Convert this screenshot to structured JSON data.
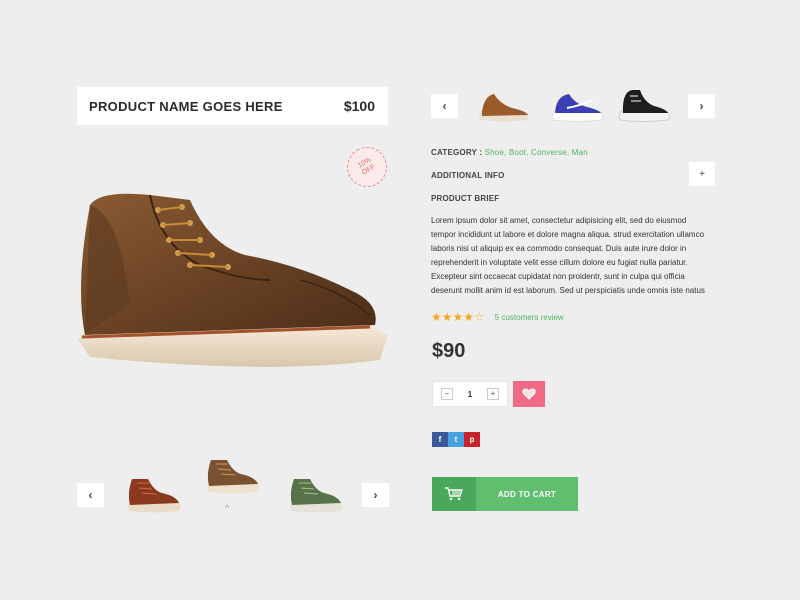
{
  "product": {
    "name": "PRODUCT NAME GOES HERE",
    "price": "$100"
  },
  "badge": {
    "line1": "10%",
    "line2": "OFF"
  },
  "gallery": {
    "prev_icon": "chevron-left-icon",
    "next_icon": "chevron-right-icon",
    "thumbnails": [
      "brown-boot",
      "tan-boot",
      "green-boot"
    ]
  },
  "related": {
    "prev_icon": "chevron-left-icon",
    "next_icon": "chevron-right-icon",
    "items": [
      "brown-casual-shoe",
      "blue-sneaker",
      "black-high-top"
    ]
  },
  "details": {
    "category_label": "CATEGORY :",
    "category_values": "Shoe, Boot, Converse, Man",
    "additional_info_label": "ADDITIONAL INFO",
    "brief_label": "PRODUCT BRIEF",
    "brief_lines": [
      "Lorem ipsum dolor sit amet, consectetur adipisicing elit, sed do eiusmod",
      "tempor incididunt ut labore et dolore magna aliqua. strud exercitation ullamco",
      "laboris nisi ut aliquip ex ea commodo consequat. Duis aute irure dolor in",
      "reprehenderit in voluptate velit esse cillum dolore eu fugiat nulla pariatur.",
      "Excepteur sint occaecat cupidatat non proidentr, sunt in culpa qui officia",
      "deserunt mollit anim id est laborum.  Sed ut perspiciatis unde omnis iste natus"
    ]
  },
  "rating": {
    "stars": "★★★★☆",
    "value": 3.5,
    "reviews": "5 customers review"
  },
  "sale_price": "$90",
  "quantity": {
    "minus": "−",
    "value": "1",
    "plus": "+"
  },
  "social": {
    "facebook": "f",
    "twitter": "t",
    "pinterest": "p"
  },
  "cart": {
    "label": "ADD TO CART"
  },
  "colors": {
    "accent_green": "#5fbf6f",
    "wish_pink": "#f06a86",
    "star": "#f5a623"
  }
}
